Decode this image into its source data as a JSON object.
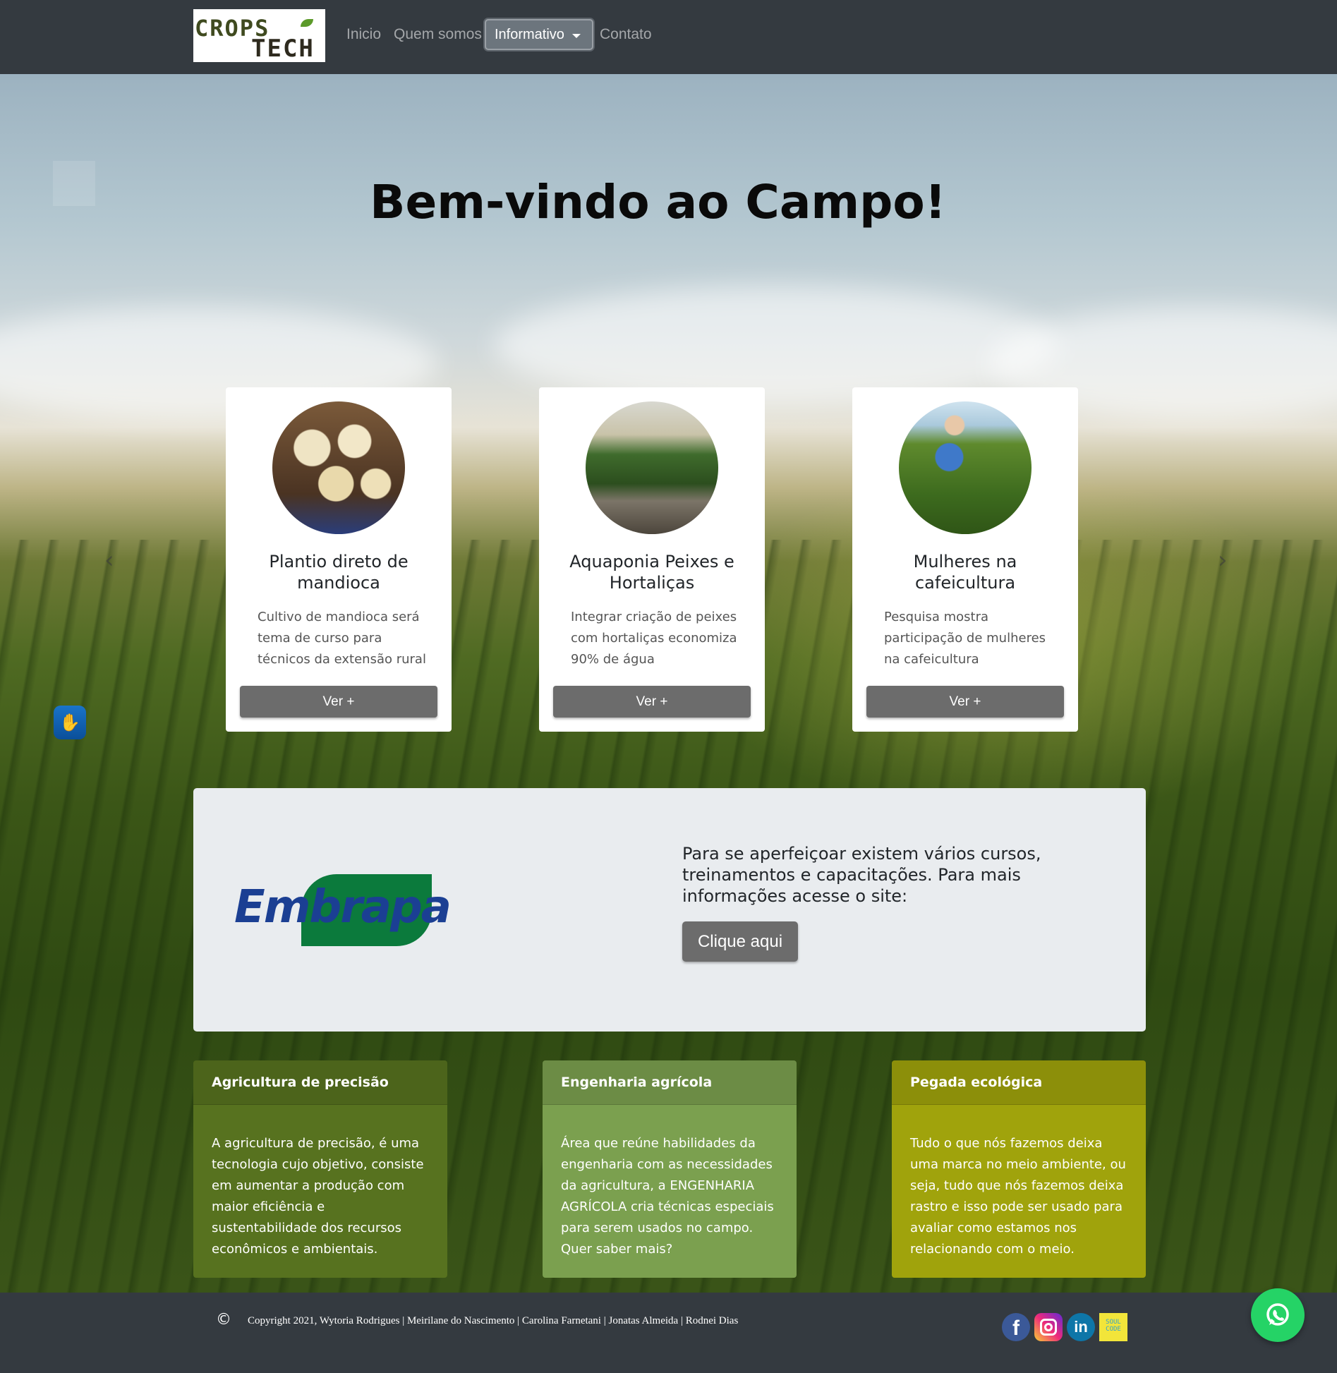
{
  "nav": {
    "logo_line1": "CROPS",
    "logo_line2": "TECH",
    "links": [
      "Inicio",
      "Quem somos",
      "Contato"
    ],
    "dropdown_label": "Informativo"
  },
  "hero": {
    "title": "Bem-vindo ao Campo!",
    "prev_icon": "‹",
    "next_icon": "›"
  },
  "cards": [
    {
      "title": "Plantio direto de mandioca",
      "text": "Cultivo de mandioca será tema de curso para técnicos da extensão rural",
      "button": "Ver +"
    },
    {
      "title": "Aquaponia Peixes e Hortaliças",
      "text": "Integrar criação de peixes com hortaliças economiza 90% de água",
      "button": "Ver +"
    },
    {
      "title": "Mulheres na cafeicultura",
      "text": "Pesquisa mostra participação de mulheres na cafeicultura",
      "button": "Ver +"
    }
  ],
  "embrapa": {
    "logo_text": "Embrapa",
    "text": "Para se aperfeiçoar existem vários cursos, treinamentos e capacitações. Para mais informações acesse o site:",
    "button": "Clique aqui"
  },
  "info_boxes": [
    {
      "title": "Agricultura de precisão",
      "text": "A agricultura de precisão, é uma tecnologia cujo objetivo, consiste em aumentar a produção com maior eficiência e sustentabilidade dos recursos econômicos e ambientais.",
      "color": "#57721f"
    },
    {
      "title": "Engenharia agrícola",
      "text": "Área que reúne habilidades da engenharia com as necessidades da agricultura, a ENGENHARIA AGRÍCOLA cria técnicas especiais para serem usados no campo. Quer saber mais?",
      "color": "#7ba04f"
    },
    {
      "title": "Pegada ecológica",
      "text": "Tudo o que nós fazemos deixa uma marca no meio ambiente, ou seja, tudo que nós fazemos deixa rastro e isso pode ser usado para avaliar como estamos nos relacionando com o meio.",
      "color": "#a0a30c"
    }
  ],
  "footer": {
    "copyright_symbol": "©",
    "copyright": "Copyright 2021, Wytoria Rodrigues | Meirilane do Nascimento | Carolina Farnetani | Jonatas Almeida | Rodnei Dias",
    "social": {
      "facebook": "f",
      "linkedin": "in",
      "soulcode_line1": "SOUL",
      "soulcode_line2": "CODE"
    }
  }
}
